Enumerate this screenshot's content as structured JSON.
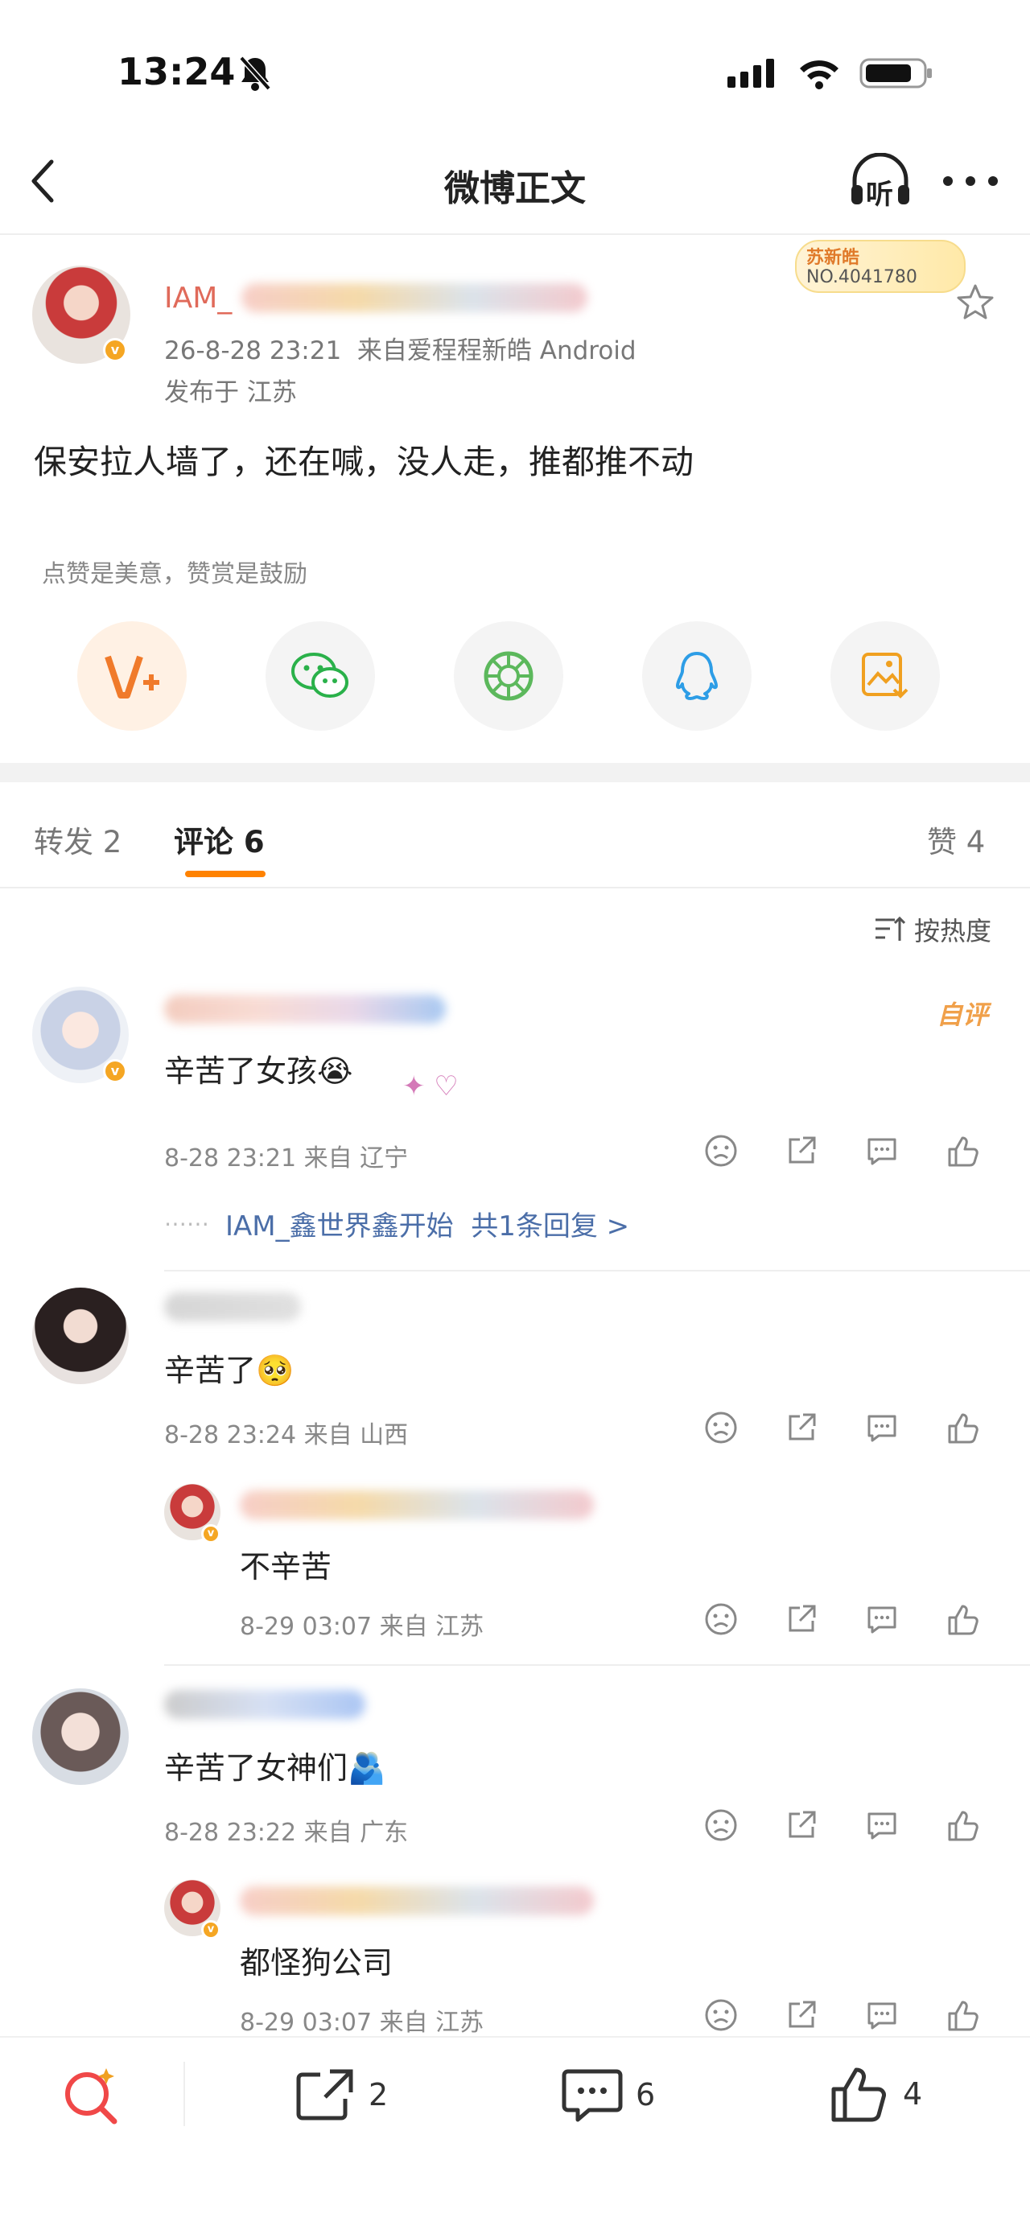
{
  "status_bar": {
    "time": "13:24"
  },
  "nav": {
    "title": "微博正文",
    "listen_label": "听"
  },
  "post": {
    "author_name": "IAM_",
    "fan_badge_name": "苏新皓",
    "fan_badge_no": "NO.4041780",
    "time_source": "26-8-28 23:21  来自爱程程新皓 Android",
    "location": "发布于 江苏",
    "text": "保安拉人墙了，还在喊，没人走，推都推不动",
    "reward_hint": "点赞是美意，赞赏是鼓励"
  },
  "share_icons": [
    "vplus-icon",
    "wechat-icon",
    "moments-icon",
    "qq-icon",
    "save-image-icon"
  ],
  "tabs": {
    "repost": "转发 2",
    "comments": "评论 6",
    "likes": "赞 4"
  },
  "sort_label": "按热度",
  "comments": [
    {
      "text": "辛苦了女孩😭",
      "meta": "8-28 23:21 来自 辽宁",
      "author_tag": "自评",
      "reply_link": "IAM_鑫世界鑫开始  共1条回复 >"
    },
    {
      "text": "辛苦了🥺",
      "meta": "8-28 23:24 来自 山西",
      "reply": {
        "text": "不辛苦",
        "meta": "8-29 03:07 来自 江苏"
      }
    },
    {
      "text": "辛苦了女神们🫂",
      "meta": "8-28 23:22 来自 广东",
      "reply": {
        "text": "都怪狗公司",
        "meta": "8-29 03:07 来自 江苏"
      }
    }
  ],
  "bottom_bar": {
    "repost_count": "2",
    "comment_count": "6",
    "like_count": "4"
  },
  "colors": {
    "accent": "#ff8200",
    "link": "#4b6ea8",
    "gray": "#888888"
  }
}
